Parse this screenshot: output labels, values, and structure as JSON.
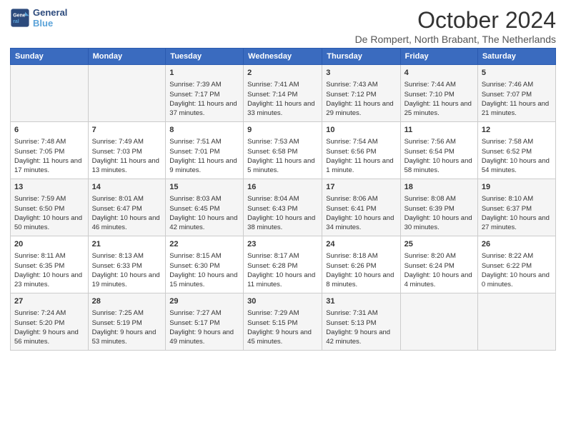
{
  "logo": {
    "line1": "General",
    "line2": "Blue"
  },
  "title": "October 2024",
  "subtitle": "De Rompert, North Brabant, The Netherlands",
  "days_of_week": [
    "Sunday",
    "Monday",
    "Tuesday",
    "Wednesday",
    "Thursday",
    "Friday",
    "Saturday"
  ],
  "weeks": [
    [
      {
        "day": "",
        "content": ""
      },
      {
        "day": "",
        "content": ""
      },
      {
        "day": "1",
        "content": "Sunrise: 7:39 AM\nSunset: 7:17 PM\nDaylight: 11 hours and 37 minutes."
      },
      {
        "day": "2",
        "content": "Sunrise: 7:41 AM\nSunset: 7:14 PM\nDaylight: 11 hours and 33 minutes."
      },
      {
        "day": "3",
        "content": "Sunrise: 7:43 AM\nSunset: 7:12 PM\nDaylight: 11 hours and 29 minutes."
      },
      {
        "day": "4",
        "content": "Sunrise: 7:44 AM\nSunset: 7:10 PM\nDaylight: 11 hours and 25 minutes."
      },
      {
        "day": "5",
        "content": "Sunrise: 7:46 AM\nSunset: 7:07 PM\nDaylight: 11 hours and 21 minutes."
      }
    ],
    [
      {
        "day": "6",
        "content": "Sunrise: 7:48 AM\nSunset: 7:05 PM\nDaylight: 11 hours and 17 minutes."
      },
      {
        "day": "7",
        "content": "Sunrise: 7:49 AM\nSunset: 7:03 PM\nDaylight: 11 hours and 13 minutes."
      },
      {
        "day": "8",
        "content": "Sunrise: 7:51 AM\nSunset: 7:01 PM\nDaylight: 11 hours and 9 minutes."
      },
      {
        "day": "9",
        "content": "Sunrise: 7:53 AM\nSunset: 6:58 PM\nDaylight: 11 hours and 5 minutes."
      },
      {
        "day": "10",
        "content": "Sunrise: 7:54 AM\nSunset: 6:56 PM\nDaylight: 11 hours and 1 minute."
      },
      {
        "day": "11",
        "content": "Sunrise: 7:56 AM\nSunset: 6:54 PM\nDaylight: 10 hours and 58 minutes."
      },
      {
        "day": "12",
        "content": "Sunrise: 7:58 AM\nSunset: 6:52 PM\nDaylight: 10 hours and 54 minutes."
      }
    ],
    [
      {
        "day": "13",
        "content": "Sunrise: 7:59 AM\nSunset: 6:50 PM\nDaylight: 10 hours and 50 minutes."
      },
      {
        "day": "14",
        "content": "Sunrise: 8:01 AM\nSunset: 6:47 PM\nDaylight: 10 hours and 46 minutes."
      },
      {
        "day": "15",
        "content": "Sunrise: 8:03 AM\nSunset: 6:45 PM\nDaylight: 10 hours and 42 minutes."
      },
      {
        "day": "16",
        "content": "Sunrise: 8:04 AM\nSunset: 6:43 PM\nDaylight: 10 hours and 38 minutes."
      },
      {
        "day": "17",
        "content": "Sunrise: 8:06 AM\nSunset: 6:41 PM\nDaylight: 10 hours and 34 minutes."
      },
      {
        "day": "18",
        "content": "Sunrise: 8:08 AM\nSunset: 6:39 PM\nDaylight: 10 hours and 30 minutes."
      },
      {
        "day": "19",
        "content": "Sunrise: 8:10 AM\nSunset: 6:37 PM\nDaylight: 10 hours and 27 minutes."
      }
    ],
    [
      {
        "day": "20",
        "content": "Sunrise: 8:11 AM\nSunset: 6:35 PM\nDaylight: 10 hours and 23 minutes."
      },
      {
        "day": "21",
        "content": "Sunrise: 8:13 AM\nSunset: 6:33 PM\nDaylight: 10 hours and 19 minutes."
      },
      {
        "day": "22",
        "content": "Sunrise: 8:15 AM\nSunset: 6:30 PM\nDaylight: 10 hours and 15 minutes."
      },
      {
        "day": "23",
        "content": "Sunrise: 8:17 AM\nSunset: 6:28 PM\nDaylight: 10 hours and 11 minutes."
      },
      {
        "day": "24",
        "content": "Sunrise: 8:18 AM\nSunset: 6:26 PM\nDaylight: 10 hours and 8 minutes."
      },
      {
        "day": "25",
        "content": "Sunrise: 8:20 AM\nSunset: 6:24 PM\nDaylight: 10 hours and 4 minutes."
      },
      {
        "day": "26",
        "content": "Sunrise: 8:22 AM\nSunset: 6:22 PM\nDaylight: 10 hours and 0 minutes."
      }
    ],
    [
      {
        "day": "27",
        "content": "Sunrise: 7:24 AM\nSunset: 5:20 PM\nDaylight: 9 hours and 56 minutes."
      },
      {
        "day": "28",
        "content": "Sunrise: 7:25 AM\nSunset: 5:19 PM\nDaylight: 9 hours and 53 minutes."
      },
      {
        "day": "29",
        "content": "Sunrise: 7:27 AM\nSunset: 5:17 PM\nDaylight: 9 hours and 49 minutes."
      },
      {
        "day": "30",
        "content": "Sunrise: 7:29 AM\nSunset: 5:15 PM\nDaylight: 9 hours and 45 minutes."
      },
      {
        "day": "31",
        "content": "Sunrise: 7:31 AM\nSunset: 5:13 PM\nDaylight: 9 hours and 42 minutes."
      },
      {
        "day": "",
        "content": ""
      },
      {
        "day": "",
        "content": ""
      }
    ]
  ]
}
